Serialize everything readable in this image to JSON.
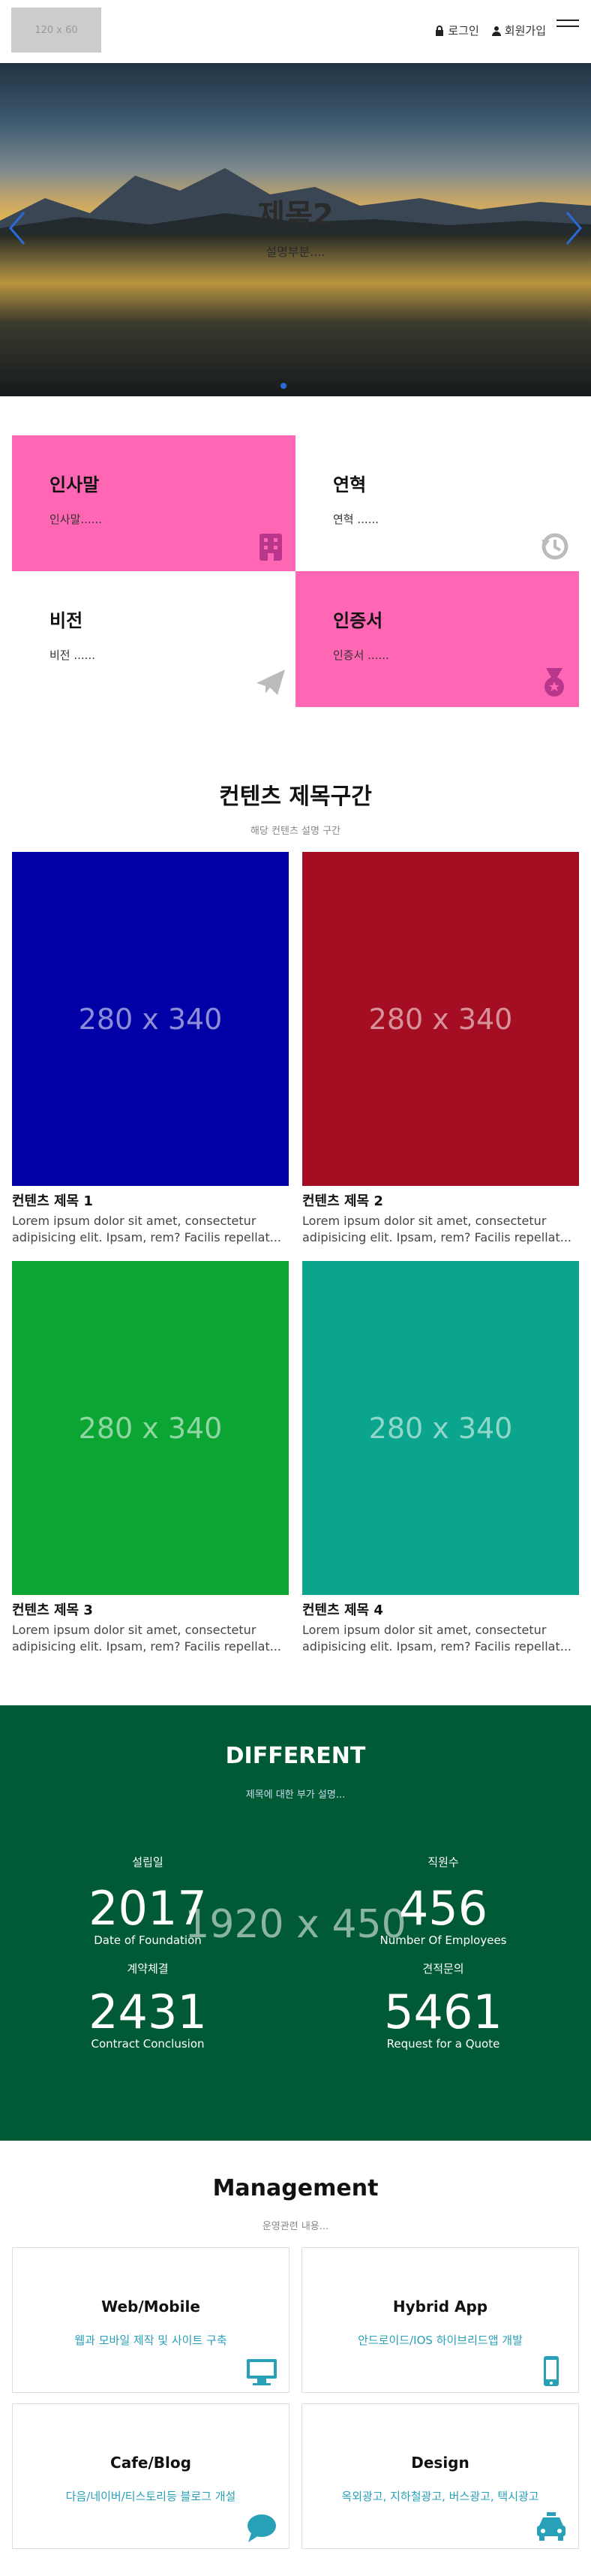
{
  "header": {
    "logo_text": "120 x 60",
    "login_label": "로그인",
    "signup_label": "회원가입"
  },
  "hero": {
    "title": "제목2",
    "subtitle": "설명부분....",
    "active_slide": 1,
    "slide_count": 1
  },
  "features": [
    {
      "title": "인사말",
      "desc": "인사말......",
      "icon": "building-icon",
      "bg": "#ff66b4"
    },
    {
      "title": "연혁",
      "desc": "연혁 ......",
      "icon": "history-icon",
      "bg": "#ffffff"
    },
    {
      "title": "비전",
      "desc": "비전 ......",
      "icon": "paper-plane-icon",
      "bg": "#ffffff"
    },
    {
      "title": "인증서",
      "desc": "인증서 ......",
      "icon": "medal-icon",
      "bg": "#ff66b4"
    }
  ],
  "contents": {
    "title": "컨텐츠 제목구간",
    "subtitle": "해당 컨텐츠 설명 구간",
    "cards": [
      {
        "placeholder": "280 x 340",
        "color": "#0000a6",
        "title": "컨텐츠 제목 1",
        "text": "Lorem ipsum dolor sit amet, consectetur adipisicing elit. Ipsam, rem? Facilis repellat..."
      },
      {
        "placeholder": "280 x 340",
        "color": "#a50d23",
        "title": "컨텐츠 제목 2",
        "text": "Lorem ipsum dolor sit amet, consectetur adipisicing elit. Ipsam, rem? Facilis repellat..."
      },
      {
        "placeholder": "280 x 340",
        "color": "#0aa532",
        "title": "컨텐츠 제목 3",
        "text": "Lorem ipsum dolor sit amet, consectetur adipisicing elit. Ipsam, rem? Facilis repellat..."
      },
      {
        "placeholder": "280 x 340",
        "color": "#0aa58c",
        "title": "컨텐츠 제목 4",
        "text": "Lorem ipsum dolor sit amet, consectetur adipisicing elit. Ipsam, rem? Facilis repellat..."
      }
    ]
  },
  "different": {
    "title": "DIFFERENT",
    "subtitle": "제목에 대한 부가 설명...",
    "watermark": "1920 x 450",
    "stats": [
      {
        "caption": "설립일",
        "number": "2017",
        "label": "Date of Foundation"
      },
      {
        "caption": "직원수",
        "number": "456",
        "label": "Number Of Employees"
      },
      {
        "caption": "계약체결",
        "number": "2431",
        "label": "Contract Conclusion"
      },
      {
        "caption": "견적문의",
        "number": "5461",
        "label": "Request for a Quote"
      }
    ]
  },
  "management": {
    "title": "Management",
    "subtitle": "운영관련 내용...",
    "services": [
      {
        "title": "Web/Mobile",
        "desc": "웹과 모바일 제작 및 사이트 구축",
        "icon": "desktop-icon"
      },
      {
        "title": "Hybrid App",
        "desc": "안드로이드/IOS 하이브리드앱 개발",
        "icon": "mobile-icon"
      },
      {
        "title": "Cafe/Blog",
        "desc": "다음/네이버/티스토리등 블로그 개설",
        "icon": "chat-icon"
      },
      {
        "title": "Design",
        "desc": "옥외광고, 지하철광고, 버스광고, 택시광고",
        "icon": "taxi-icon"
      }
    ]
  },
  "colors": {
    "pink": "#ff66b4",
    "green_section": "#015a36",
    "accent_blue": "#28a0b8"
  }
}
